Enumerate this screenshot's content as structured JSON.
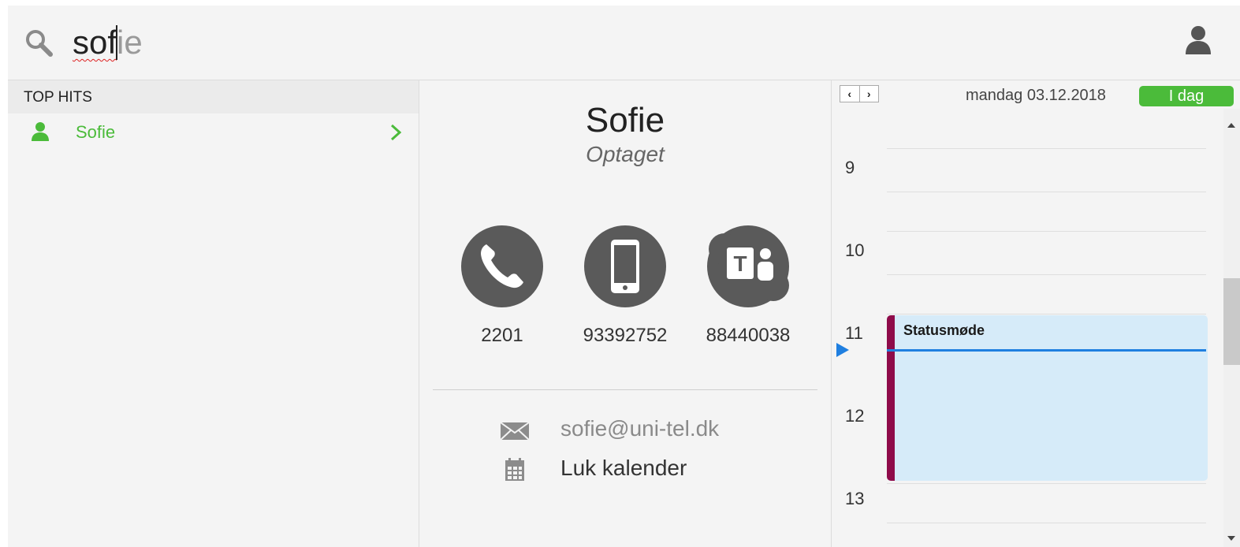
{
  "search": {
    "typed": "sof",
    "completion": "ie"
  },
  "top_hits": {
    "header": "TOP HITS",
    "items": [
      {
        "name": "Sofie",
        "icon": "user-icon"
      }
    ]
  },
  "contact": {
    "name": "Sofie",
    "status": "Optaget",
    "channels": [
      {
        "icon": "phone-icon",
        "number": "2201"
      },
      {
        "icon": "mobile-icon",
        "number": "93392752"
      },
      {
        "icon": "teams-icon",
        "number": "88440038"
      }
    ],
    "email": "sofie@uni-tel.dk",
    "calendar_link": "Luk kalender"
  },
  "calendar": {
    "date": "mandag 03.12.2018",
    "today_label": "I dag",
    "prev_label": "‹",
    "next_label": "›",
    "hours": [
      "9",
      "10",
      "11",
      "12",
      "13"
    ],
    "events": [
      {
        "title": "Statusmøde",
        "color": "#8e0b4a",
        "background": "#d6ebf9"
      }
    ]
  },
  "colors": {
    "accent_green": "#4bbb3a",
    "now_line": "#1f7fe0",
    "icon_gray": "#5a5a5a"
  }
}
